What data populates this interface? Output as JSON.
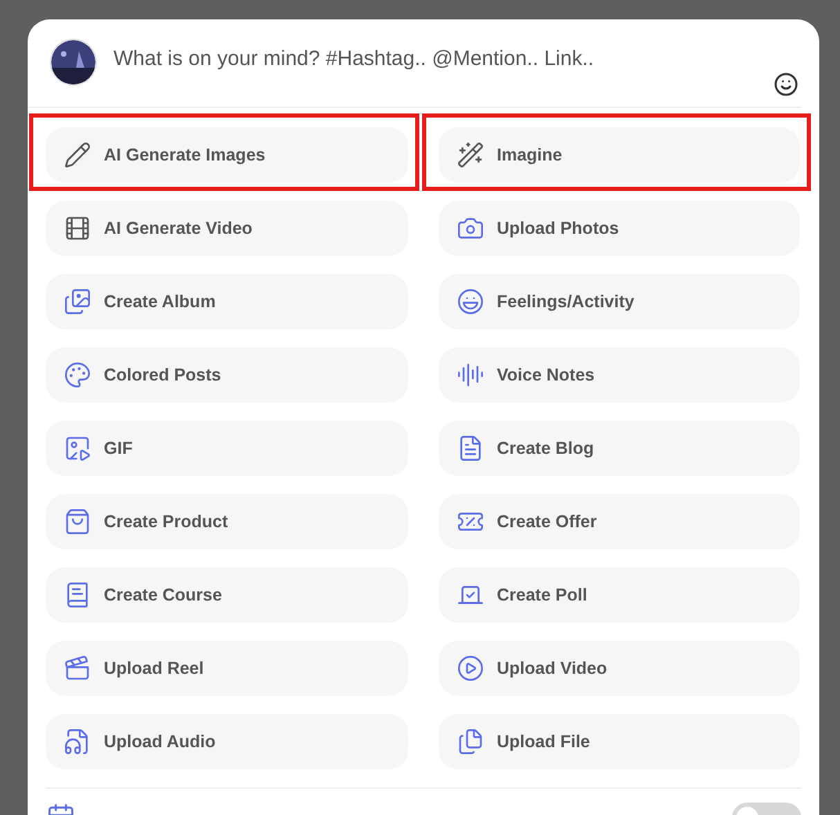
{
  "composer": {
    "placeholder": "What is on your mind? #Hashtag.. @Mention.. Link.."
  },
  "actions": [
    {
      "label": "AI Generate Images",
      "highlighted": true
    },
    {
      "label": "Imagine",
      "highlighted": true
    },
    {
      "label": "AI Generate Video",
      "highlighted": false
    },
    {
      "label": "Upload Photos",
      "highlighted": false
    },
    {
      "label": "Create Album",
      "highlighted": false
    },
    {
      "label": "Feelings/Activity",
      "highlighted": false
    },
    {
      "label": "Colored Posts",
      "highlighted": false
    },
    {
      "label": "Voice Notes",
      "highlighted": false
    },
    {
      "label": "GIF",
      "highlighted": false
    },
    {
      "label": "Create Blog",
      "highlighted": false
    },
    {
      "label": "Create Product",
      "highlighted": false
    },
    {
      "label": "Create Offer",
      "highlighted": false
    },
    {
      "label": "Create Course",
      "highlighted": false
    },
    {
      "label": "Create Poll",
      "highlighted": false
    },
    {
      "label": "Upload Reel",
      "highlighted": false
    },
    {
      "label": "Upload Video",
      "highlighted": false
    },
    {
      "label": "Upload Audio",
      "highlighted": false
    },
    {
      "label": "Upload File",
      "highlighted": false
    }
  ],
  "schedule": {
    "on": false
  }
}
